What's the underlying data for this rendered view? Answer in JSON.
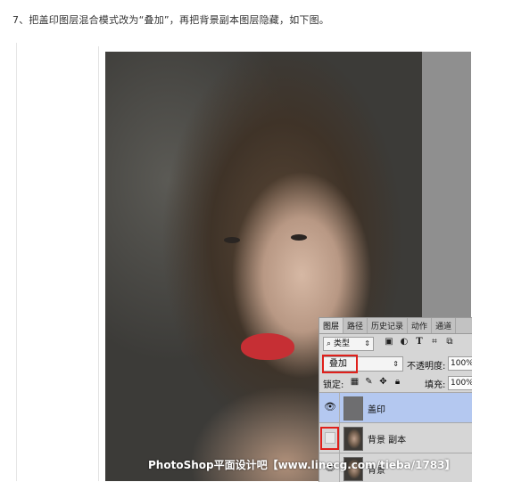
{
  "article": {
    "step_text": "7、把盖印图层混合模式改为“叠加”，再把背景副本图层隐藏，如下图。",
    "watermark": "PhotoShop平面设计吧【www.linecg.com/tieba/1783】"
  },
  "layers_panel": {
    "tabs": [
      {
        "label": "图层",
        "active": true
      },
      {
        "label": "路径",
        "active": false
      },
      {
        "label": "历史记录",
        "active": false
      },
      {
        "label": "动作",
        "active": false
      },
      {
        "label": "通道",
        "active": false
      }
    ],
    "filter": {
      "icon": "search-icon",
      "label": "类型",
      "icons": [
        "image-filter-icon",
        "adjustment-filter-icon",
        "type-filter-icon",
        "shape-filter-icon",
        "smart-object-filter-icon"
      ]
    },
    "blend_mode": "叠加",
    "opacity_label": "不透明度:",
    "opacity_value": "100%",
    "lock_label": "锁定:",
    "fill_label": "填充:",
    "fill_value": "100%",
    "layers": [
      {
        "name": "盖印",
        "visible": true,
        "selected": true,
        "thumb": "gray"
      },
      {
        "name": "背景 副本",
        "visible": false,
        "selected": false,
        "thumb": "portrait"
      },
      {
        "name": "背景",
        "visible": true,
        "selected": false,
        "thumb": "portrait"
      }
    ],
    "highlight_color": "#e0201b",
    "selected_color": "#b4c8f0"
  }
}
